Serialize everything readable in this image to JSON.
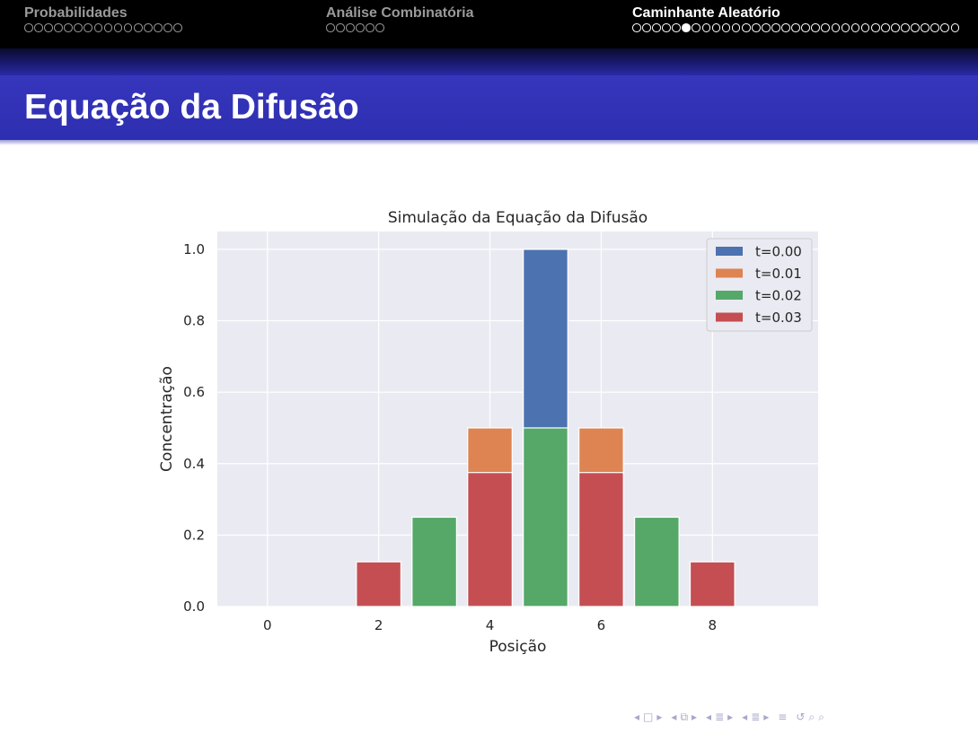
{
  "header": {
    "sections": [
      {
        "label": "Probabilidades",
        "dots": 16,
        "current_dot": null,
        "active": false
      },
      {
        "label": "Análise Combinatória",
        "dots": 6,
        "current_dot": null,
        "active": false
      },
      {
        "label": "Caminhante Aleatório",
        "dots": 33,
        "current_dot": 5,
        "active": true
      }
    ]
  },
  "slide": {
    "title": "Equação da Difusão"
  },
  "chart_data": {
    "type": "bar",
    "stacked": false,
    "title": "Simulação da Equação da Difusão",
    "xlabel": "Posição",
    "ylabel": "Concentração",
    "xlim": [
      -0.9,
      9.9
    ],
    "ylim": [
      0,
      1.05
    ],
    "x_ticks": [
      0,
      2,
      4,
      6,
      8
    ],
    "y_ticks": [
      0.0,
      0.2,
      0.4,
      0.6,
      0.8,
      1.0
    ],
    "y_tick_format": 1,
    "grid": true,
    "legend_position": "top-right",
    "x": [
      0,
      1,
      2,
      3,
      4,
      5,
      6,
      7,
      8,
      9
    ],
    "series": [
      {
        "name": "t=0.00",
        "color": "#4c72b0",
        "values": [
          0,
          0,
          0,
          0,
          0,
          1.0,
          0,
          0,
          0,
          0
        ]
      },
      {
        "name": "t=0.01",
        "color": "#dd8452",
        "values": [
          0,
          0,
          0,
          0,
          0.5,
          0,
          0.5,
          0,
          0,
          0
        ]
      },
      {
        "name": "t=0.02",
        "color": "#55a868",
        "values": [
          0,
          0,
          0,
          0.25,
          0,
          0.5,
          0,
          0.25,
          0,
          0
        ]
      },
      {
        "name": "t=0.03",
        "color": "#c44e52",
        "values": [
          0,
          0,
          0.125,
          0,
          0.375,
          0,
          0.375,
          0,
          0.125,
          0
        ]
      }
    ]
  },
  "nav_symbols": [
    "◂",
    "□",
    "▸",
    "◂",
    "⧉",
    "▸",
    "◂",
    "≣",
    "▸",
    "◂",
    "≣",
    "▸",
    "≡",
    "↺",
    "⌕",
    "⌕"
  ]
}
